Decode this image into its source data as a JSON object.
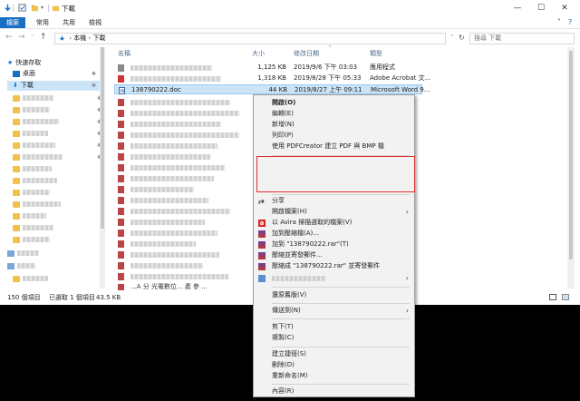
{
  "window": {
    "title": "下載",
    "controls": {
      "minimize": "—",
      "maximize": "☐",
      "close": "✕"
    }
  },
  "ribbon": {
    "tabs": [
      "檔案",
      "常用",
      "共用",
      "檢視"
    ],
    "help_glyph": "?",
    "expand_glyph": "˅"
  },
  "address": {
    "back": "←",
    "forward": "→",
    "up_menu": "˅",
    "up": "↑",
    "path": [
      "本機",
      "下載"
    ],
    "sep": "›",
    "refresh": "↻",
    "search_placeholder": "搜尋 下載"
  },
  "nav": {
    "quick_access": "快速存取",
    "desktop": "桌面",
    "downloads": "下載",
    "pin_glyph": "📌"
  },
  "columns": {
    "name": "名稱",
    "size": "大小",
    "date": "修改日期",
    "type": "類型"
  },
  "files": [
    {
      "name": "",
      "size": "1,125 KB",
      "date": "2019/9/6 下午 03:03",
      "type": "應用程式"
    },
    {
      "name": "",
      "size": "1,318 KB",
      "date": "2019/8/28 下午 05:33",
      "type": "Adobe Acrobat 文..."
    },
    {
      "name": "138790222.doc",
      "size": "44 KB",
      "date": "2019/8/27 上午 09:11",
      "type": "Microsoft Word 9..."
    }
  ],
  "status": {
    "count": "150 個項目",
    "selected": "已選取 1 個項目",
    "size": "43.5 KB"
  },
  "partial_bottom_text": "...A 分 光電數位... 產 參 ...",
  "context_menu": {
    "items": [
      {
        "label": "開啟(O)",
        "bold": true
      },
      {
        "label": "編輯(E)"
      },
      {
        "label": "新增(N)"
      },
      {
        "label": "列印(P)"
      },
      {
        "label": "使用 PDFCreator 建立 PDF 與 BMP 檔"
      },
      {
        "label": "分享"
      },
      {
        "label": "開啟檔案(H)",
        "submenu": true
      },
      {
        "label": "以 Avira 掃描選取的檔案(V)"
      },
      {
        "label": "加到壓縮檔(A)..."
      },
      {
        "label": "加到 \"138790222.rar\"(T)"
      },
      {
        "label": "壓縮並寄發郵件..."
      },
      {
        "label": "壓縮成 \"138790222.rar\" 並寄發郵件"
      },
      {
        "label": "",
        "submenu": true
      },
      {
        "label": "還原舊版(V)"
      },
      {
        "label": "傳送到(N)",
        "submenu": true
      },
      {
        "label": "剪下(T)"
      },
      {
        "label": "複製(C)"
      },
      {
        "label": "建立捷徑(S)"
      },
      {
        "label": "刪除(D)"
      },
      {
        "label": "重新命名(M)"
      },
      {
        "label": "內容(R)"
      }
    ],
    "submenu_arrow": "›"
  },
  "colors": {
    "accent": "#1a6fc4",
    "selection": "#cce4f7",
    "highlight_box": "#e03030"
  }
}
